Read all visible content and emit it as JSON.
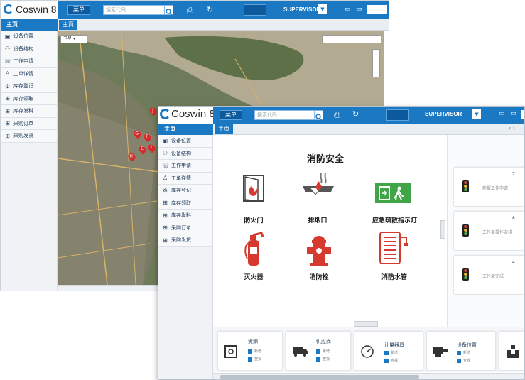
{
  "back_window": {
    "logo": "Coswin 8",
    "menu_button": "菜单",
    "search_placeholder": "搜索代码",
    "user": "SUPERVISOR",
    "tab": "主页",
    "home_header": "主页",
    "map_type": "卫星"
  },
  "front_window": {
    "logo": "Coswin 8",
    "menu_button": "菜单",
    "search_placeholder": "搜索代码",
    "user": "SUPERVISOR",
    "tab": "主页",
    "home_header": "主页",
    "sidebar_items": [
      "设备位置",
      "设备结构",
      "工作申请",
      "工单详情",
      "库存登记",
      "库存领取",
      "库存发料",
      "采购订单",
      "采购发货"
    ],
    "fire_safety": {
      "title": "消防安全",
      "items": [
        "防火门",
        "排烟口",
        "应急疏散指示灯",
        "灭火器",
        "消防栓",
        "消防水管"
      ]
    },
    "kpi_cards": [
      {
        "label": "新报工作申请",
        "count": "7"
      },
      {
        "label": "工作单操作安排",
        "count": "8"
      },
      {
        "label": "工作单完成",
        "count": "4"
      }
    ],
    "bottom_cards": [
      {
        "title": "资源",
        "sub1": "新增",
        "sub2": "查找"
      },
      {
        "title": "供应商",
        "sub1": "新增",
        "sub2": "查找"
      },
      {
        "title": "计量器具",
        "sub1": "新增",
        "sub2": "查找"
      },
      {
        "title": "设备位置",
        "sub1": "新增",
        "sub2": "查找"
      }
    ]
  },
  "colors": {
    "brand_blue": "#1b78c2",
    "fire_red": "#d63a2e",
    "exit_green": "#3fa546"
  }
}
